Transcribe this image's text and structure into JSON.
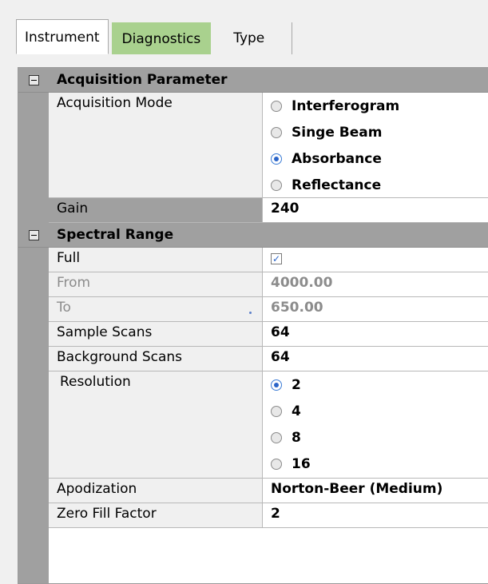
{
  "tabs": [
    {
      "label": "Instrument"
    },
    {
      "label": "Diagnostics"
    },
    {
      "label": "Type"
    }
  ],
  "acquisition": {
    "header": "Acquisition Parameter",
    "mode_label": "Acquisition Mode",
    "mode_options": [
      "Interferogram",
      "Singe Beam",
      "Absorbance",
      "Reflectance"
    ],
    "mode_selected": "Absorbance",
    "gain_label": "Gain",
    "gain_value": "240"
  },
  "spectral": {
    "header": "Spectral Range",
    "full_label": "Full",
    "full_checked": true,
    "from_label": "From",
    "from_value": "4000.00",
    "to_label": "To",
    "to_value": "650.00",
    "sample_scans_label": "Sample Scans",
    "sample_scans_value": "64",
    "background_scans_label": "Background Scans",
    "background_scans_value": "64",
    "resolution_label": "Resolution",
    "resolution_options": [
      "2",
      "4",
      "8",
      "16"
    ],
    "resolution_selected": "2",
    "apodization_label": "Apodization",
    "apodization_value": "Norton-Beer (Medium)",
    "zero_fill_label": "Zero Fill Factor",
    "zero_fill_value": "2"
  },
  "colors": {
    "diagnostics_tab": "#a9d18e",
    "category_bg": "#a0a0a0",
    "radio_selected": "#2a64c8",
    "disabled_text": "#8c8c8c"
  },
  "icons": {
    "collapse": "collapse-minus-icon",
    "check": "checkmark-icon"
  }
}
